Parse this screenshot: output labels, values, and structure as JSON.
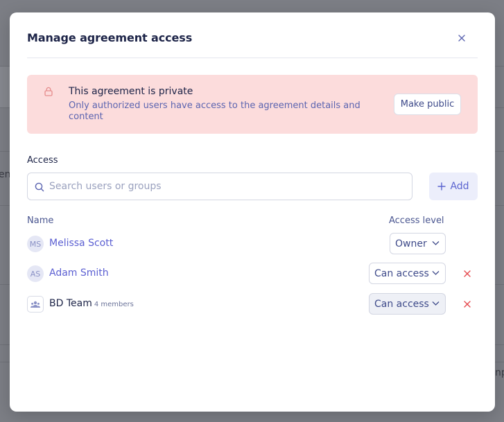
{
  "modal": {
    "title": "Manage agreement access",
    "close_icon": "close-icon"
  },
  "alert": {
    "icon": "lock-icon",
    "title": "This agreement is private",
    "description": "Only authorized users have access to the agreement details and content",
    "button_label": "Make public"
  },
  "access": {
    "label": "Access",
    "search_placeholder": "Search users or groups",
    "search_value": "",
    "add_label": "Add"
  },
  "table": {
    "col_name": "Name",
    "col_level": "Access level",
    "rows": [
      {
        "initials": "MS",
        "name": "Melissa Scott",
        "level": "Owner",
        "removable": false
      },
      {
        "initials": "AS",
        "name": "Adam Smith",
        "level": "Can access",
        "removable": true
      },
      {
        "name": "BD Team",
        "members": "4 members",
        "level": "Can access",
        "removable": true,
        "group": true
      }
    ]
  },
  "colors": {
    "accent": "#5b5fd2",
    "alert_bg": "#fcdcdc",
    "danger": "#e5484d",
    "title": "#1c2347"
  },
  "background": {
    "partial_text_left": "en",
    "partial_text_right": "np"
  }
}
